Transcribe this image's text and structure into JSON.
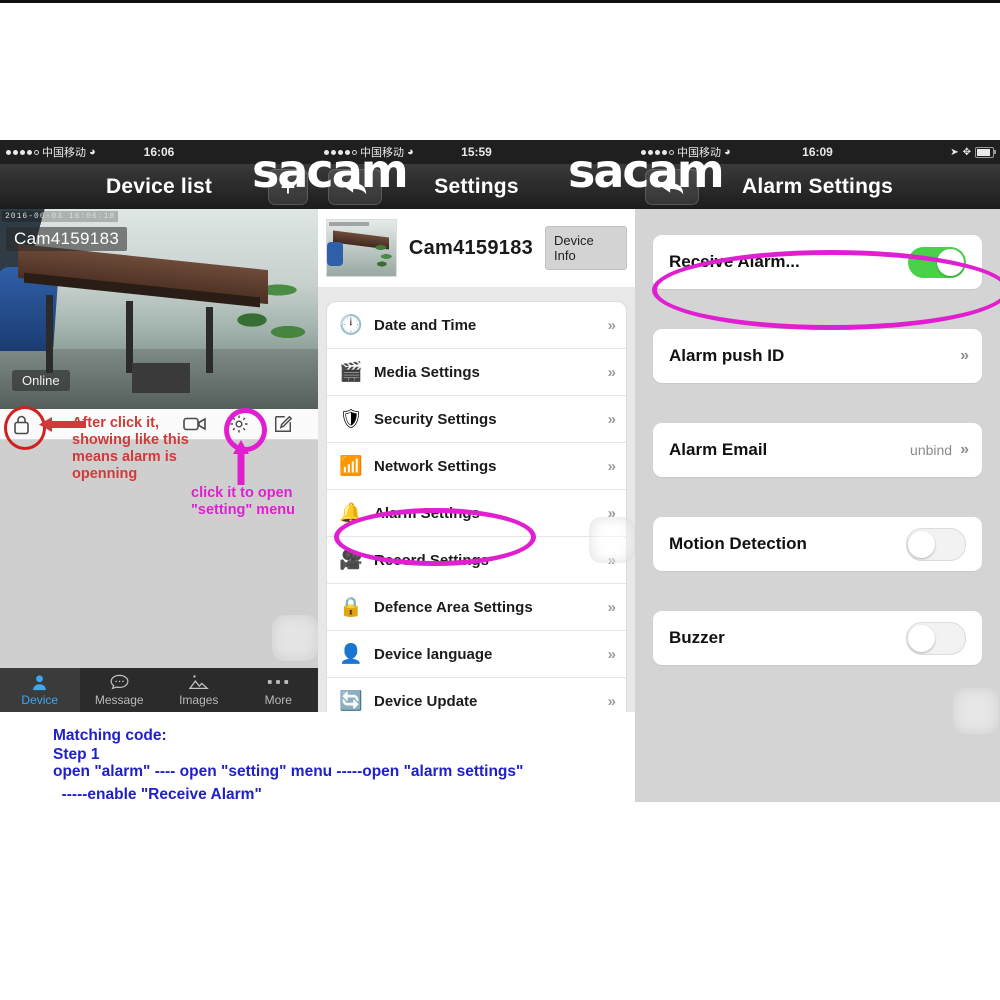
{
  "colors": {
    "magenta": "#e020d0",
    "red": "#d03a38",
    "blue": "#2020c8",
    "toggle_on_green": "#4ad14a",
    "tab_active_blue": "#3ea7f0"
  },
  "watermark": {
    "text": "sacam"
  },
  "panel_left": {
    "statusbar": {
      "carrier": "中国移动",
      "wifi_icon": "wifi-icon",
      "time": "16:06"
    },
    "navbar": {
      "title": "Device list",
      "add_button_label": "+",
      "add_icon": "plus-icon"
    },
    "video": {
      "timestamp": "2016-06-03  16:06:18",
      "camera_label": "Cam4159183",
      "status_badge": "Online"
    },
    "toolbar": {
      "lock_icon": "lock-icon",
      "video_icon": "video-camera-icon",
      "gear_icon": "gear-icon",
      "edit_icon": "edit-pencil-icon"
    },
    "tabs": [
      {
        "label": "Device",
        "icon": "person-icon",
        "active": true
      },
      {
        "label": "Message",
        "icon": "chat-bubble-icon",
        "active": false
      },
      {
        "label": "Images",
        "icon": "photo-icon",
        "active": false
      },
      {
        "label": "More",
        "icon": "ellipsis-icon",
        "active": false
      }
    ]
  },
  "panel_mid": {
    "statusbar": {
      "carrier": "中国移动",
      "wifi_icon": "wifi-icon",
      "time": "15:59"
    },
    "navbar": {
      "title": "Settings",
      "back_icon": "back-arrow-icon"
    },
    "device": {
      "name": "Cam4159183",
      "info_button": "Device Info",
      "thumb": "camera-snapshot"
    },
    "menu": [
      {
        "label": "Date and Time",
        "icon": "clock-icon",
        "chevron": "»"
      },
      {
        "label": "Media Settings",
        "icon": "film-icon",
        "chevron": "»"
      },
      {
        "label": "Security Settings",
        "icon": "shield-icon",
        "chevron": "»"
      },
      {
        "label": "Network Settings",
        "icon": "antenna-icon",
        "chevron": "»"
      },
      {
        "label": "Alarm Settings",
        "icon": "bell-icon",
        "chevron": "»"
      },
      {
        "label": "Record Settings",
        "icon": "camcorder-icon",
        "chevron": "»"
      },
      {
        "label": "Defence Area Settings",
        "icon": "padlock-icon",
        "chevron": "»"
      },
      {
        "label": "Device language",
        "icon": "user-speech-icon",
        "chevron": "»"
      },
      {
        "label": "Device Update",
        "icon": "refresh-icon",
        "chevron": "»"
      }
    ]
  },
  "panel_right": {
    "statusbar": {
      "carrier": "中国移动",
      "wifi_icon": "wifi-icon",
      "time": "16:09",
      "right_icons": [
        "location-arrow-icon",
        "bluetooth-icon",
        "battery-icon"
      ]
    },
    "navbar": {
      "title": "Alarm Settings",
      "back_icon": "back-arrow-icon"
    },
    "rows": [
      {
        "label": "Receive Alarm...",
        "control": "toggle",
        "state": "on",
        "value": ""
      },
      {
        "label": "Alarm push ID",
        "control": "chevron",
        "state": "",
        "value": "",
        "chevron": "»"
      },
      {
        "label": "Alarm Email",
        "control": "chevron",
        "state": "",
        "value": "unbind",
        "chevron": "»"
      },
      {
        "label": "Motion Detection",
        "control": "toggle",
        "state": "off",
        "value": ""
      },
      {
        "label": "Buzzer",
        "control": "toggle",
        "state": "off",
        "value": ""
      }
    ]
  },
  "annotations": {
    "red_note": "After click it,\nshowing like this\nmeans alarm is\nopenning",
    "magenta_note": "click it to open\n\"setting\" menu",
    "blue_note_line1": "Matching code:",
    "blue_note_line2": "Step 1",
    "blue_note_line3": "open \"alarm\" ---- open \"setting\" menu -----open \"alarm settings\"",
    "blue_note_line4": "  -----enable \"Receive Alarm\""
  }
}
